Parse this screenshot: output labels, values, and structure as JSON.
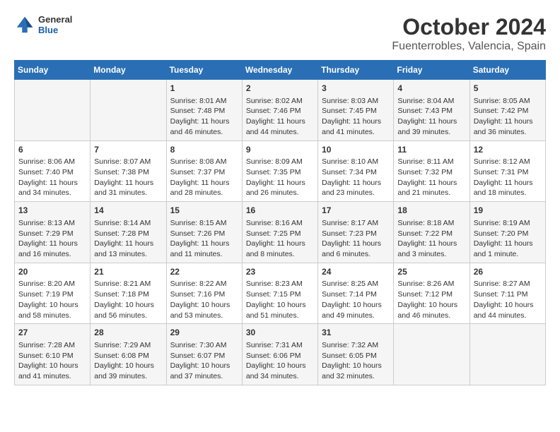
{
  "header": {
    "logo": {
      "general": "General",
      "blue": "Blue"
    },
    "title": "October 2024",
    "subtitle": "Fuenterrobles, Valencia, Spain"
  },
  "days_of_week": [
    "Sunday",
    "Monday",
    "Tuesday",
    "Wednesday",
    "Thursday",
    "Friday",
    "Saturday"
  ],
  "weeks": [
    [
      {
        "day": null,
        "data": null
      },
      {
        "day": null,
        "data": null
      },
      {
        "day": "1",
        "data": "Sunrise: 8:01 AM\nSunset: 7:48 PM\nDaylight: 11 hours and 46 minutes."
      },
      {
        "day": "2",
        "data": "Sunrise: 8:02 AM\nSunset: 7:46 PM\nDaylight: 11 hours and 44 minutes."
      },
      {
        "day": "3",
        "data": "Sunrise: 8:03 AM\nSunset: 7:45 PM\nDaylight: 11 hours and 41 minutes."
      },
      {
        "day": "4",
        "data": "Sunrise: 8:04 AM\nSunset: 7:43 PM\nDaylight: 11 hours and 39 minutes."
      },
      {
        "day": "5",
        "data": "Sunrise: 8:05 AM\nSunset: 7:42 PM\nDaylight: 11 hours and 36 minutes."
      }
    ],
    [
      {
        "day": "6",
        "data": "Sunrise: 8:06 AM\nSunset: 7:40 PM\nDaylight: 11 hours and 34 minutes."
      },
      {
        "day": "7",
        "data": "Sunrise: 8:07 AM\nSunset: 7:38 PM\nDaylight: 11 hours and 31 minutes."
      },
      {
        "day": "8",
        "data": "Sunrise: 8:08 AM\nSunset: 7:37 PM\nDaylight: 11 hours and 28 minutes."
      },
      {
        "day": "9",
        "data": "Sunrise: 8:09 AM\nSunset: 7:35 PM\nDaylight: 11 hours and 26 minutes."
      },
      {
        "day": "10",
        "data": "Sunrise: 8:10 AM\nSunset: 7:34 PM\nDaylight: 11 hours and 23 minutes."
      },
      {
        "day": "11",
        "data": "Sunrise: 8:11 AM\nSunset: 7:32 PM\nDaylight: 11 hours and 21 minutes."
      },
      {
        "day": "12",
        "data": "Sunrise: 8:12 AM\nSunset: 7:31 PM\nDaylight: 11 hours and 18 minutes."
      }
    ],
    [
      {
        "day": "13",
        "data": "Sunrise: 8:13 AM\nSunset: 7:29 PM\nDaylight: 11 hours and 16 minutes."
      },
      {
        "day": "14",
        "data": "Sunrise: 8:14 AM\nSunset: 7:28 PM\nDaylight: 11 hours and 13 minutes."
      },
      {
        "day": "15",
        "data": "Sunrise: 8:15 AM\nSunset: 7:26 PM\nDaylight: 11 hours and 11 minutes."
      },
      {
        "day": "16",
        "data": "Sunrise: 8:16 AM\nSunset: 7:25 PM\nDaylight: 11 hours and 8 minutes."
      },
      {
        "day": "17",
        "data": "Sunrise: 8:17 AM\nSunset: 7:23 PM\nDaylight: 11 hours and 6 minutes."
      },
      {
        "day": "18",
        "data": "Sunrise: 8:18 AM\nSunset: 7:22 PM\nDaylight: 11 hours and 3 minutes."
      },
      {
        "day": "19",
        "data": "Sunrise: 8:19 AM\nSunset: 7:20 PM\nDaylight: 11 hours and 1 minute."
      }
    ],
    [
      {
        "day": "20",
        "data": "Sunrise: 8:20 AM\nSunset: 7:19 PM\nDaylight: 10 hours and 58 minutes."
      },
      {
        "day": "21",
        "data": "Sunrise: 8:21 AM\nSunset: 7:18 PM\nDaylight: 10 hours and 56 minutes."
      },
      {
        "day": "22",
        "data": "Sunrise: 8:22 AM\nSunset: 7:16 PM\nDaylight: 10 hours and 53 minutes."
      },
      {
        "day": "23",
        "data": "Sunrise: 8:23 AM\nSunset: 7:15 PM\nDaylight: 10 hours and 51 minutes."
      },
      {
        "day": "24",
        "data": "Sunrise: 8:25 AM\nSunset: 7:14 PM\nDaylight: 10 hours and 49 minutes."
      },
      {
        "day": "25",
        "data": "Sunrise: 8:26 AM\nSunset: 7:12 PM\nDaylight: 10 hours and 46 minutes."
      },
      {
        "day": "26",
        "data": "Sunrise: 8:27 AM\nSunset: 7:11 PM\nDaylight: 10 hours and 44 minutes."
      }
    ],
    [
      {
        "day": "27",
        "data": "Sunrise: 7:28 AM\nSunset: 6:10 PM\nDaylight: 10 hours and 41 minutes."
      },
      {
        "day": "28",
        "data": "Sunrise: 7:29 AM\nSunset: 6:08 PM\nDaylight: 10 hours and 39 minutes."
      },
      {
        "day": "29",
        "data": "Sunrise: 7:30 AM\nSunset: 6:07 PM\nDaylight: 10 hours and 37 minutes."
      },
      {
        "day": "30",
        "data": "Sunrise: 7:31 AM\nSunset: 6:06 PM\nDaylight: 10 hours and 34 minutes."
      },
      {
        "day": "31",
        "data": "Sunrise: 7:32 AM\nSunset: 6:05 PM\nDaylight: 10 hours and 32 minutes."
      },
      {
        "day": null,
        "data": null
      },
      {
        "day": null,
        "data": null
      }
    ]
  ]
}
